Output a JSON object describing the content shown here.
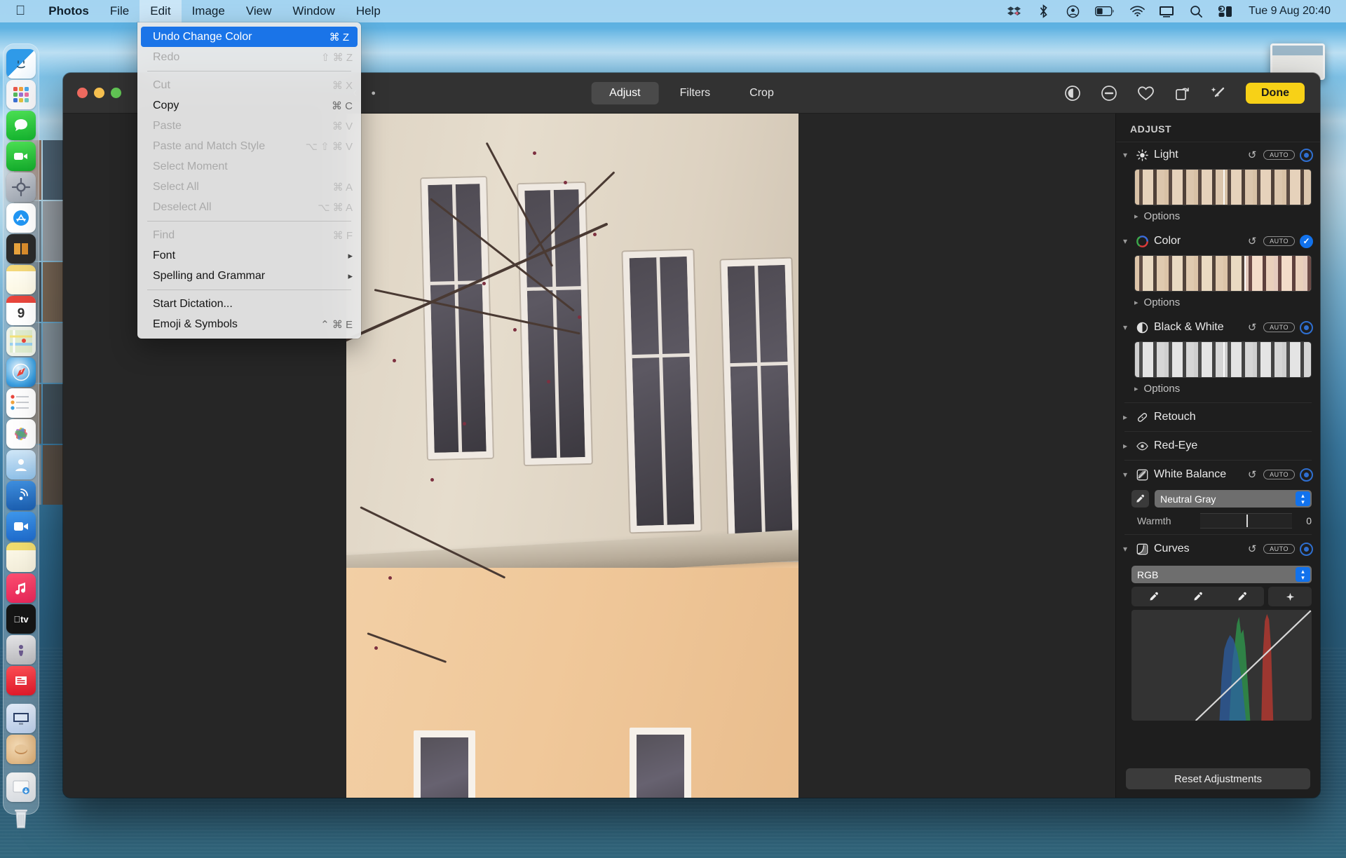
{
  "menubar": {
    "apple_icon": "apple-logo-icon",
    "items": [
      {
        "label": "Photos",
        "bold": true,
        "active": false
      },
      {
        "label": "File",
        "bold": false,
        "active": false
      },
      {
        "label": "Edit",
        "bold": false,
        "active": true
      },
      {
        "label": "Image",
        "bold": false,
        "active": false
      },
      {
        "label": "View",
        "bold": false,
        "active": false
      },
      {
        "label": "Window",
        "bold": false,
        "active": false
      },
      {
        "label": "Help",
        "bold": false,
        "active": false
      }
    ],
    "status_icons": [
      "dropbox-icon",
      "bluetooth-icon",
      "user-account-icon",
      "battery-icon",
      "wifi-icon",
      "display-icon",
      "search-icon",
      "control-center-icon"
    ],
    "clock": "Tue 9 Aug  20:40"
  },
  "edit_menu": {
    "items": [
      {
        "label": "Undo Change Color",
        "shortcut": "⌘ Z",
        "state": "highlighted",
        "submenu": false
      },
      {
        "label": "Redo",
        "shortcut": "⇧ ⌘ Z",
        "state": "disabled",
        "submenu": false
      },
      {
        "separator": true
      },
      {
        "label": "Cut",
        "shortcut": "⌘ X",
        "state": "disabled",
        "submenu": false
      },
      {
        "label": "Copy",
        "shortcut": "⌘ C",
        "state": "enabled",
        "submenu": false
      },
      {
        "label": "Paste",
        "shortcut": "⌘ V",
        "state": "disabled",
        "submenu": false
      },
      {
        "label": "Paste and Match Style",
        "shortcut": "⌥ ⇧ ⌘ V",
        "state": "disabled",
        "submenu": false
      },
      {
        "label": "Select Moment",
        "shortcut": "",
        "state": "disabled",
        "submenu": false
      },
      {
        "label": "Select All",
        "shortcut": "⌘ A",
        "state": "disabled",
        "submenu": false
      },
      {
        "label": "Deselect All",
        "shortcut": "⌥ ⌘ A",
        "state": "disabled",
        "submenu": false
      },
      {
        "separator": true
      },
      {
        "label": "Find",
        "shortcut": "⌘ F",
        "state": "disabled",
        "submenu": false
      },
      {
        "label": "Font",
        "shortcut": "",
        "state": "enabled",
        "submenu": true
      },
      {
        "label": "Spelling and Grammar",
        "shortcut": "",
        "state": "enabled",
        "submenu": true
      },
      {
        "separator": true
      },
      {
        "label": "Start Dictation...",
        "shortcut": "",
        "state": "enabled",
        "submenu": false
      },
      {
        "label": "Emoji & Symbols",
        "shortcut": "⌃ ⌘ E",
        "state": "enabled",
        "submenu": false
      }
    ]
  },
  "window": {
    "traffic_lights": [
      "close",
      "minimize",
      "zoom"
    ],
    "tabs": [
      {
        "label": "Adjust",
        "selected": true
      },
      {
        "label": "Filters",
        "selected": false
      },
      {
        "label": "Crop",
        "selected": false
      }
    ],
    "toolbar_right_icons": [
      "info-icon",
      "remove-icon",
      "favorite-heart-icon",
      "rotate-icon",
      "auto-enhance-wand-icon"
    ],
    "done_label": "Done"
  },
  "adjust_panel": {
    "title": "ADJUST",
    "options_label": "Options",
    "auto_label": "AUTO",
    "reset_label": "Reset Adjustments",
    "sections": [
      {
        "name": "Light",
        "icon": "sun-icon",
        "expanded": true,
        "has_controls": true,
        "enabled": false,
        "strip_type": "color",
        "marker_pct": 50
      },
      {
        "name": "Color",
        "icon": "color-wheel-icon",
        "expanded": true,
        "has_controls": true,
        "enabled": true,
        "strip_type": "color",
        "marker_pct": 62
      },
      {
        "name": "Black & White",
        "icon": "contrast-circle-icon",
        "expanded": true,
        "has_controls": true,
        "enabled": false,
        "strip_type": "gray",
        "marker_pct": 50
      },
      {
        "name": "Retouch",
        "icon": "bandage-icon",
        "expanded": false,
        "has_controls": false,
        "enabled": false
      },
      {
        "name": "Red-Eye",
        "icon": "eye-icon",
        "expanded": false,
        "has_controls": false,
        "enabled": false
      },
      {
        "name": "White Balance",
        "icon": "white-balance-icon",
        "expanded": true,
        "has_controls": true,
        "enabled": false
      },
      {
        "name": "Curves",
        "icon": "curves-icon",
        "expanded": true,
        "has_controls": true,
        "enabled": false
      }
    ],
    "white_balance": {
      "mode_value": "Neutral Gray",
      "eyedropper_icon": "eyedropper-icon",
      "warmth_label": "Warmth",
      "warmth_value": "0"
    },
    "curves": {
      "channel_value": "RGB",
      "eyedropper_buttons": [
        "black-point-eyedropper",
        "gray-point-eyedropper",
        "white-point-eyedropper"
      ],
      "add_point_button": "add-point-icon"
    }
  },
  "dock": {
    "items": [
      {
        "name": "finder",
        "running": true
      },
      {
        "name": "launchpad",
        "running": false
      },
      {
        "name": "messages",
        "running": false
      },
      {
        "name": "facetime",
        "running": false
      },
      {
        "name": "system-preferences",
        "running": false
      },
      {
        "name": "app-store",
        "running": false
      },
      {
        "name": "books",
        "running": false
      },
      {
        "name": "notes",
        "running": false
      },
      {
        "name": "calendar",
        "running": false
      },
      {
        "name": "maps",
        "running": true
      },
      {
        "name": "safari",
        "running": true
      },
      {
        "name": "reminders",
        "running": false
      },
      {
        "name": "photos",
        "running": true
      },
      {
        "name": "contacts",
        "running": false
      },
      {
        "name": "airdrop",
        "running": false
      },
      {
        "name": "video",
        "running": false
      },
      {
        "name": "stickies",
        "running": false
      },
      {
        "name": "music",
        "running": false
      },
      {
        "name": "apple-tv",
        "running": false
      },
      {
        "name": "podcasts",
        "running": false
      },
      {
        "name": "news",
        "running": false
      },
      {
        "name": "keynote",
        "running": false
      },
      {
        "name": "preview",
        "running": false
      },
      {
        "name": "downloads",
        "running": false
      },
      {
        "name": "trash",
        "running": false
      }
    ]
  }
}
